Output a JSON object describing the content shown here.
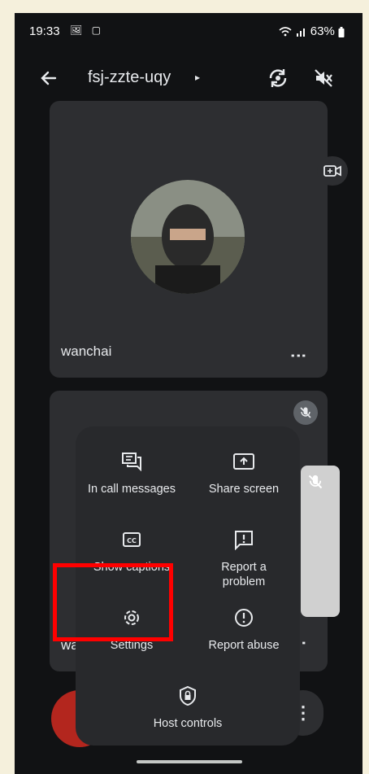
{
  "status_bar": {
    "time": "19:33",
    "icons": "🖼 ▢",
    "battery": "63%"
  },
  "header": {
    "meeting_code": "fsj-zzte-uqy",
    "caret": "▸"
  },
  "participants": [
    {
      "name": "wanchai"
    },
    {
      "name": "wa"
    }
  ],
  "menu": {
    "items": [
      {
        "label": "In call messages",
        "icon": "chat-icon"
      },
      {
        "label": "Share screen",
        "icon": "share-screen-icon"
      },
      {
        "label": "Show captions",
        "icon": "captions-icon"
      },
      {
        "label": "Report a problem",
        "icon": "report-problem-icon"
      },
      {
        "label": "Settings",
        "icon": "gear-icon"
      },
      {
        "label": "Report abuse",
        "icon": "alert-circle-icon"
      },
      {
        "label": "Host controls",
        "icon": "host-lock-icon"
      }
    ]
  },
  "colors": {
    "background": "#111214",
    "tile": "#2d2e31",
    "menu": "#28292c",
    "end_call": "#b3261e",
    "highlight": "#ff0000"
  }
}
